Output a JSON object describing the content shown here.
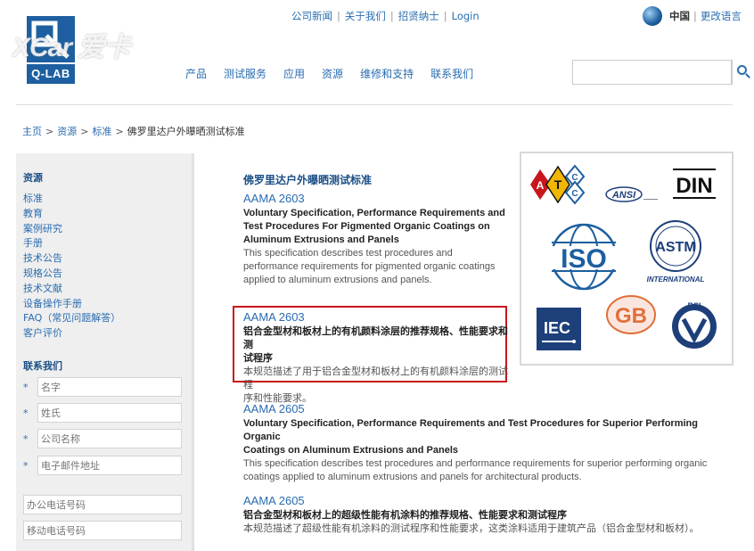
{
  "brand": {
    "logo_text": "Q-LAB",
    "watermark": "XCar 爱卡"
  },
  "top_links": [
    "公司新闻",
    "关于我们",
    "招贤纳士",
    "Login"
  ],
  "language": {
    "current": "中国",
    "change": "更改语言"
  },
  "nav": [
    "产品",
    "测试服务",
    "应用",
    "资源",
    "维修和支持",
    "联系我们"
  ],
  "search": {
    "placeholder": ""
  },
  "breadcrumb": [
    "主页",
    "资源",
    "标准",
    "佛罗里达户外曝晒测试标准"
  ],
  "sidebar": {
    "heading": "资源",
    "links": [
      "标准",
      "教育",
      "案例研究",
      "手册",
      "技术公告",
      "规格公告",
      "技术文献",
      "设备操作手册",
      "FAQ（常见问题解答）",
      "客户评价"
    ],
    "contact_heading": "联系我们",
    "required_fields": [
      "名字",
      "姓氏",
      "公司名称",
      "电子邮件地址"
    ],
    "optional_fields": [
      "办公电话号码",
      "移动电话号码"
    ]
  },
  "content": {
    "heading": "佛罗里达户外曝晒测试标准",
    "entries": [
      {
        "code": "AAMA 2603",
        "title_lines": [
          "Voluntary Specification, Performance Requirements and",
          "Test Procedures For Pigmented Organic Coatings on",
          "Aluminum Extrusions and Panels"
        ],
        "desc_lines": [
          "This specification describes test procedures and",
          "performance requirements for pigmented organic coatings",
          "applied to aluminum extrusions and panels."
        ]
      },
      {
        "code": "AAMA 2603",
        "title_lines": [
          "铝合金型材和板材上的有机颜料涂层的推荐规格、性能要求和测",
          "试程序"
        ],
        "desc_lines": [
          "本规范描述了用于铝合金型材和板材上的有机颜料涂层的测试程",
          "序和性能要求。"
        ]
      },
      {
        "code": "AAMA 2605",
        "title_lines": [
          "Voluntary Specification, Performance Requirements and Test Procedures for Superior Performing Organic",
          "Coatings on Aluminum Extrusions and Panels"
        ],
        "desc_lines": [
          "This specification describes test procedures and performance requirements for superior performing organic",
          "coatings applied to aluminum extrusions and panels for architectural products."
        ]
      },
      {
        "code": "AAMA 2605",
        "title_lines": [
          "铝合金型材和板材上的超级性能有机涂料的推荐规格、性能要求和测试程序"
        ],
        "desc_lines": [
          "本规范描述了超级性能有机涂料的测试程序和性能要求，这类涂料适用于建筑产品（铝合金型材和板材）。"
        ]
      }
    ]
  },
  "standards_logos": {
    "atcc": [
      "A",
      "T",
      "C",
      "C"
    ],
    "ansi": "ANSI",
    "din": "DIN",
    "iso": "ISO",
    "astm": "ASTM",
    "astm_sub": "INTERNATIONAL",
    "iec": "IEC",
    "gb": "GB",
    "bsi": "BSI"
  },
  "colors": {
    "link": "#2a6cb0",
    "heading": "#1a4f86",
    "highlight": "#c8161d",
    "brand": "#1d5fa0"
  }
}
